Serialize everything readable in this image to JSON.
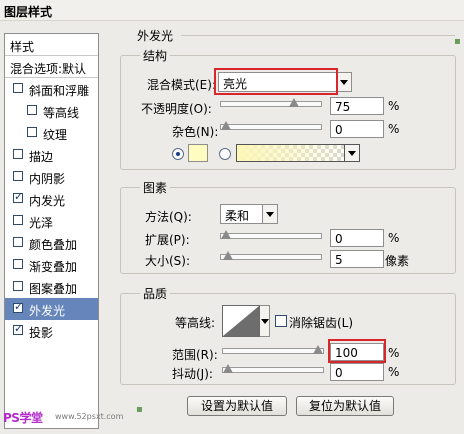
{
  "window": {
    "title": "图层样式"
  },
  "sidebar": {
    "header": "样式",
    "blend_default": "混合选项:默认",
    "items": [
      {
        "label": "斜面和浮雕",
        "checked": false,
        "indent": false,
        "selected": false
      },
      {
        "label": "等高线",
        "checked": false,
        "indent": true,
        "selected": false
      },
      {
        "label": "纹理",
        "checked": false,
        "indent": true,
        "selected": false
      },
      {
        "label": "描边",
        "checked": false,
        "indent": false,
        "selected": false
      },
      {
        "label": "内阴影",
        "checked": false,
        "indent": false,
        "selected": false
      },
      {
        "label": "内发光",
        "checked": true,
        "indent": false,
        "selected": false
      },
      {
        "label": "光泽",
        "checked": false,
        "indent": false,
        "selected": false
      },
      {
        "label": "颜色叠加",
        "checked": false,
        "indent": false,
        "selected": false
      },
      {
        "label": "渐变叠加",
        "checked": false,
        "indent": false,
        "selected": false
      },
      {
        "label": "图案叠加",
        "checked": false,
        "indent": false,
        "selected": false
      },
      {
        "label": "外发光",
        "checked": true,
        "indent": false,
        "selected": true
      },
      {
        "label": "投影",
        "checked": true,
        "indent": false,
        "selected": false
      }
    ]
  },
  "watermark": {
    "logo": "PS学堂",
    "site": "www.52psxt.com"
  },
  "panel": {
    "title": "外发光",
    "structure": {
      "caption": "结构",
      "blend_mode_label": "混合模式(E):",
      "blend_mode_value": "亮光",
      "opacity_label": "不透明度(O):",
      "opacity_value": "75",
      "opacity_level": 0.75,
      "opacity_unit": "%",
      "noise_label": "杂色(N):",
      "noise_value": "0",
      "noise_level": 0,
      "noise_unit": "%",
      "color_swatch": "#fefcc1"
    },
    "elements": {
      "caption": "图素",
      "method_label": "方法(Q):",
      "method_value": "柔和",
      "spread_label": "扩展(P):",
      "spread_value": "0",
      "spread_level": 0,
      "spread_unit": "%",
      "size_label": "大小(S):",
      "size_value": "5",
      "size_level": 0.02,
      "size_unit": "像素"
    },
    "quality": {
      "caption": "品质",
      "contour_label": "等高线:",
      "anti_alias_label": "消除锯齿(L)",
      "range_label": "范围(R):",
      "range_value": "100",
      "range_level": 1.0,
      "range_unit": "%",
      "jitter_label": "抖动(J):",
      "jitter_value": "0",
      "jitter_level": 0,
      "jitter_unit": "%"
    },
    "buttons": {
      "make_default": "设置为默认值",
      "reset_default": "复位为默认值"
    }
  },
  "colors": {
    "selected_row": "#6585bb",
    "highlight_box": "#d8262a"
  }
}
